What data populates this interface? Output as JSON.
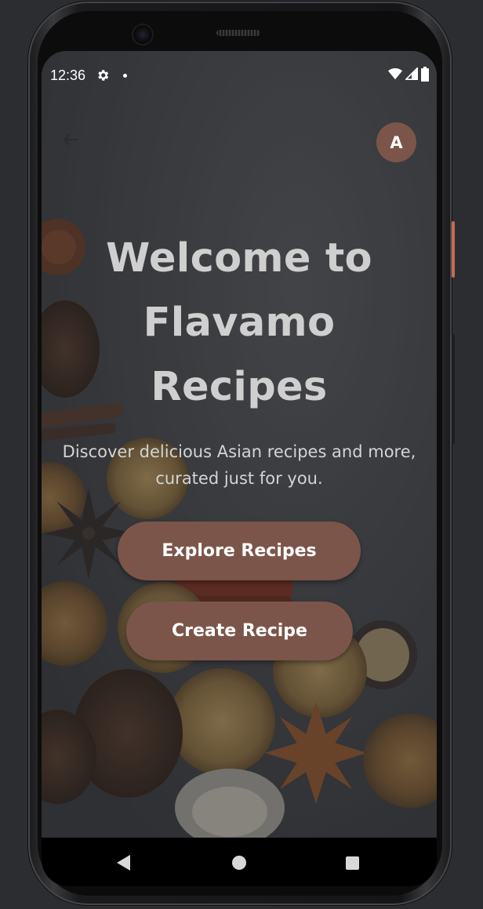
{
  "status_bar": {
    "time": "12:36",
    "icons": [
      "settings-icon",
      "notification-dot-icon",
      "wifi-icon",
      "signal-icon",
      "battery-icon"
    ]
  },
  "app_bar": {
    "back_icon": "arrow-left-icon",
    "avatar_initial": "A"
  },
  "hero": {
    "title": "Welcome to Flavamo Recipes",
    "subtitle": "Discover delicious Asian recipes and more, curated just for you."
  },
  "actions": {
    "explore_label": "Explore Recipes",
    "create_label": "Create Recipe"
  },
  "nav_bar": {
    "icons": [
      "nav-back-icon",
      "nav-home-icon",
      "nav-recents-icon"
    ]
  },
  "colors": {
    "accent": "#7c554a",
    "title_text": "#cfcfcf",
    "subtitle_text": "#d4d4d4",
    "button_text": "#ffffff",
    "frame_side_button": "#c46b55"
  }
}
